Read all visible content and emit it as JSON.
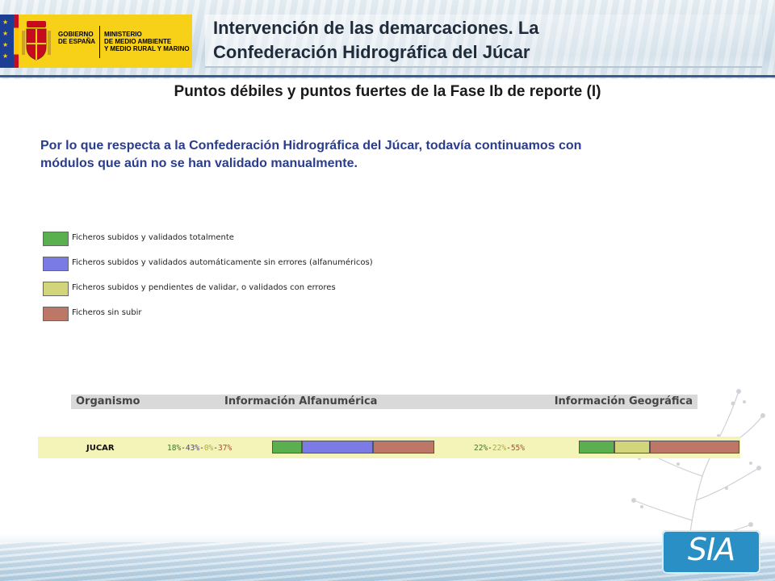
{
  "header": {
    "gov_logo": {
      "line1": "GOBIERNO",
      "line2": "DE ESPAÑA",
      "ministry_line1": "MINISTERIO",
      "ministry_line2": "DE MEDIO AMBIENTE",
      "ministry_line3": "Y MEDIO RURAL Y MARINO"
    },
    "title_line1": "Intervención de las demarcaciones. La",
    "title_line2": "Confederación Hidrográfica del Júcar"
  },
  "subtitle": "Puntos débiles y puntos fuertes de la Fase Ib de reporte (I)",
  "paragraph_line1": "Por lo que respecta a la Confederación Hidrográfica del Júcar, todavía continuamos con",
  "paragraph_line2": "módulos que aún no se han validado manualmente.",
  "legend": [
    {
      "label": "Ficheros subidos y validados totalmente",
      "color": "#5aaf4e"
    },
    {
      "label": "Ficheros subidos y validados automáticamente sin errores (alfanuméricos)",
      "color": "#7b7be6"
    },
    {
      "label": "Ficheros subidos y pendientes de validar, o validados con errores",
      "color": "#d3d57a"
    },
    {
      "label": "Ficheros sin subir",
      "color": "#bd7766"
    }
  ],
  "table": {
    "headers": {
      "organismo": "Organismo",
      "alfanumerica": "Información Alfanumérica",
      "geografica": "Información Geográfica"
    },
    "row": {
      "organismo": "JUCAR",
      "alfa": {
        "parts": [
          {
            "text": "18%",
            "color": "#2e7d32"
          },
          {
            "text": "-",
            "color": "#333333"
          },
          {
            "text": "43%",
            "color": "#4b3fb0"
          },
          {
            "text": "-",
            "color": "#333333"
          },
          {
            "text": "0%",
            "color": "#b5a93a"
          },
          {
            "text": "-",
            "color": "#333333"
          },
          {
            "text": "37%",
            "color": "#b24a3a"
          }
        ],
        "segments": [
          18,
          43,
          0,
          37
        ]
      },
      "geo": {
        "parts": [
          {
            "text": "22%",
            "color": "#2e7d32"
          },
          {
            "text": "-",
            "color": "#333333"
          },
          {
            "text": "22%",
            "color": "#b5a93a"
          },
          {
            "text": "-",
            "color": "#333333"
          },
          {
            "text": "55%",
            "color": "#b24a3a"
          }
        ],
        "segments": [
          22,
          0,
          22,
          55
        ]
      }
    }
  },
  "footer_logo": {
    "text": "SIA"
  },
  "colors": {
    "accent_blue": "#2a3c8c",
    "header_line": "#3a5b8f",
    "row_bg": "#f4f4b8",
    "green": "#5aaf4e",
    "blue": "#7b7be6",
    "khaki": "#d3d57a",
    "brown": "#bd7766"
  }
}
